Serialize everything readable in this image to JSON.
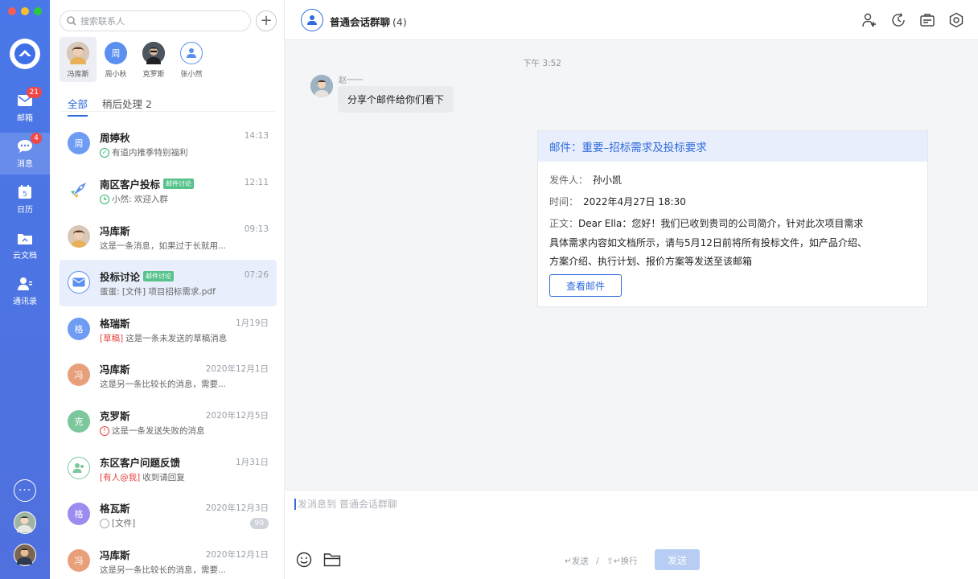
{
  "nav": {
    "items": [
      {
        "label": "邮箱",
        "icon": "mail-icon",
        "badge": "21"
      },
      {
        "label": "消息",
        "icon": "chat-icon",
        "badge": "4",
        "active": true
      },
      {
        "label": "日历",
        "icon": "calendar-icon"
      },
      {
        "label": "云文档",
        "icon": "cloud-doc-icon"
      },
      {
        "label": "通讯录",
        "icon": "contacts-icon"
      }
    ]
  },
  "list": {
    "search_placeholder": "搜索联系人",
    "recent": [
      {
        "name": "冯库斯",
        "kind": "photo",
        "color": "#c99a7a"
      },
      {
        "name": "周小秋",
        "kind": "text",
        "initial": "周",
        "color": "#5b8ff0"
      },
      {
        "name": "克罗斯",
        "kind": "photo",
        "color": "#3c4650"
      },
      {
        "name": "张小然",
        "kind": "group",
        "color": "#5b8ff0"
      }
    ],
    "tabs": {
      "all": "全部",
      "later": "稍后处理 2"
    },
    "conversations": [
      {
        "initial": "周",
        "color": "#6f9cf3",
        "name": "周婷秋",
        "tag": "",
        "time": "14:13",
        "prefix": "",
        "preview": "有道内推季特别福利",
        "mini": "check"
      },
      {
        "initial": "",
        "color": "#ffffff",
        "name": "南区客户投标",
        "tag": "邮件讨论",
        "time": "12:11",
        "prefix": "",
        "preview": "小然: 欢迎入群",
        "mini": "clock"
      },
      {
        "initial": "",
        "color": "#c99a7a",
        "name": "冯库斯",
        "tag": "",
        "time": "09:13",
        "prefix": "",
        "preview": "这是一条消息，如果过于长就用...",
        "mini": ""
      },
      {
        "initial": "",
        "color": "#ffffff",
        "name": "投标讨论",
        "tag": "邮件讨论",
        "time": "07:26",
        "prefix": "",
        "preview": "蛋蛋: [文件] 项目招标需求.pdf",
        "mini": "",
        "selected": true
      },
      {
        "initial": "格",
        "color": "#6f9cf3",
        "name": "格瑞斯",
        "tag": "",
        "time": "1月19日",
        "prefix": "[草稿]",
        "preview": "这是一条未发送的草稿消息",
        "mini": ""
      },
      {
        "initial": "冯",
        "color": "#e8a07a",
        "name": "冯库斯",
        "tag": "",
        "time": "2020年12月1日",
        "prefix": "",
        "preview": "这是另一条比较长的消息，需要...",
        "mini": ""
      },
      {
        "initial": "克",
        "color": "#7cc79c",
        "name": "克罗斯",
        "tag": "",
        "time": "2020年12月5日",
        "prefix": "",
        "preview": "这是一条发送失败的消息",
        "mini": "error"
      },
      {
        "initial": "",
        "color": "#ffffff",
        "name": "东区客户问题反馈",
        "tag": "",
        "time": "1月31日",
        "prefix": "[有人@我]",
        "preview": "收到请回复",
        "mini": ""
      },
      {
        "initial": "格",
        "color": "#9b8cf0",
        "name": "格瓦斯",
        "tag": "",
        "time": "2020年12月3日",
        "prefix": "",
        "preview": "[文件]",
        "mini": "circle",
        "count": "99"
      },
      {
        "initial": "冯",
        "color": "#e8a07a",
        "name": "冯库斯",
        "tag": "",
        "time": "2020年12月1日",
        "prefix": "",
        "preview": "这是另一条比较长的消息，需要...",
        "mini": ""
      }
    ]
  },
  "chat": {
    "title": "普通会话群聊",
    "member_count": "(4)",
    "timestamp": "下午 3:52",
    "sender": "赵一一",
    "message": "分享个邮件给你们看下",
    "mail": {
      "subject": "邮件：重要–招标需求及投标要求",
      "from_label": "发件人：",
      "from": "孙小凯",
      "time_label": "时间：",
      "time": "2022年4月27日 18:30",
      "body_label": "正文：",
      "body_line1": "Dear Ella：您好！我们已收到贵司的公司简介，针对此次项目需求",
      "body_line2": "具体需求内容如文档所示，请与5月12日前将所有投标文件，如产品介绍、",
      "body_line3": "方案介绍、执行计划、报价方案等发送至该邮箱",
      "view_button": "查看邮件"
    },
    "composer": {
      "placeholder": "发消息到 普通会话群聊",
      "hint_send": "↵发送",
      "hint_sep": "/",
      "hint_newline": "⇧↵换行",
      "send_button": "发送"
    }
  },
  "colors": {
    "accent": "#2f6bdc",
    "nav_bg": "#4a78e8",
    "badge": "#f04848",
    "tag_green": "#57c28c"
  }
}
